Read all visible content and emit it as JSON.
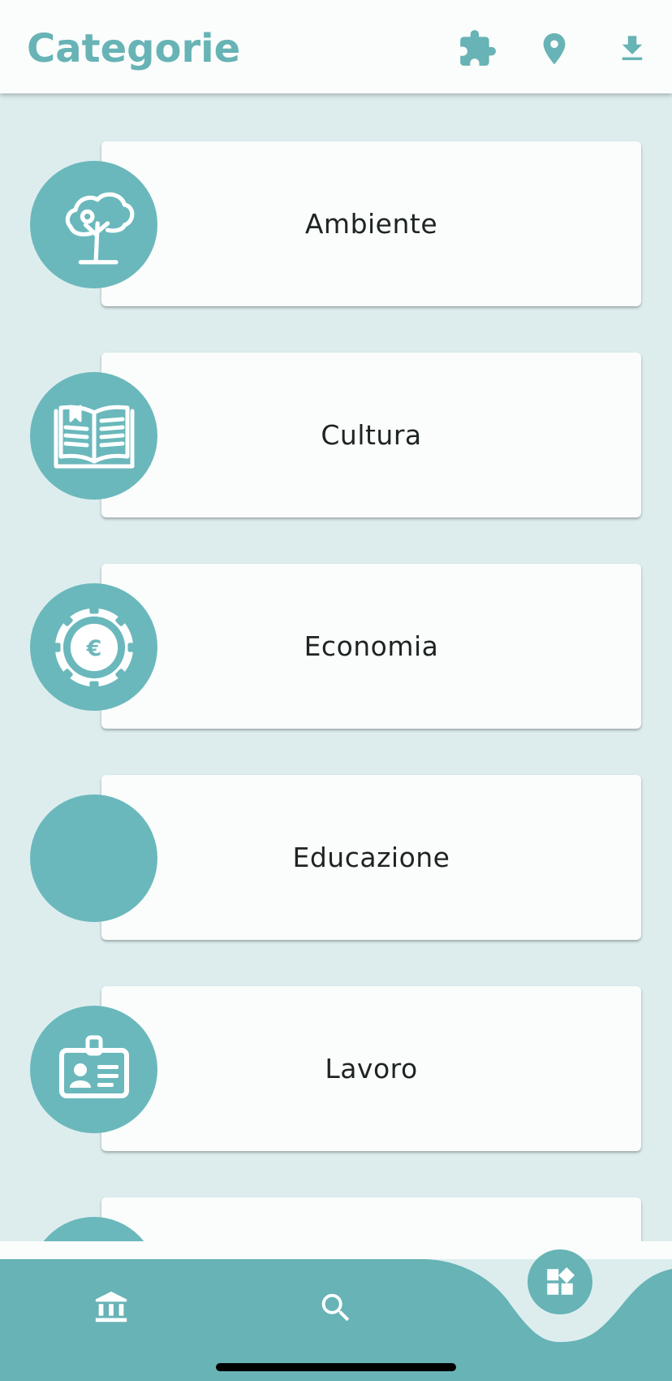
{
  "header": {
    "title": "Categorie",
    "actions": [
      {
        "name": "puzzle-button",
        "icon": "puzzle-icon"
      },
      {
        "name": "location-button",
        "icon": "map-pin-icon"
      },
      {
        "name": "download-button",
        "icon": "download-icon"
      }
    ]
  },
  "categories": [
    {
      "label": "Ambiente",
      "icon": "tree-icon"
    },
    {
      "label": "Cultura",
      "icon": "open-book-icon"
    },
    {
      "label": "Economia",
      "icon": "euro-coin-icon"
    },
    {
      "label": "Educazione",
      "icon": ""
    },
    {
      "label": "Lavoro",
      "icon": "id-badge-icon"
    },
    {
      "label": "",
      "icon": ""
    }
  ],
  "bottom_nav": {
    "items": [
      {
        "name": "home",
        "icon": "museum-icon"
      },
      {
        "name": "search",
        "icon": "search-icon"
      },
      {
        "name": "categories",
        "icon": "categories-grid-icon",
        "selected": true
      }
    ]
  },
  "colors": {
    "accent": "#67B3B6",
    "icon_circle": "#6AB8BC",
    "background": "#DDEDEE",
    "card": "#FAFDFB",
    "text": "#1E2424"
  }
}
